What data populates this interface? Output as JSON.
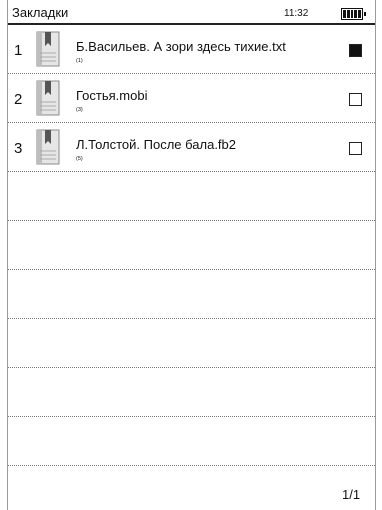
{
  "status": {
    "title": "Закладки",
    "time": "11:32",
    "battery_icon": "battery-full-icon"
  },
  "bookmarks": [
    {
      "index": "1",
      "title": "Б.Васильев. А зори здесь тихие.txt",
      "count": "(1)",
      "checked": true
    },
    {
      "index": "2",
      "title": "Гостья.mobi",
      "count": "(3)",
      "checked": false
    },
    {
      "index": "3",
      "title": "Л.Толстой. После бала.fb2",
      "count": "(5)",
      "checked": false
    }
  ],
  "pager": "1/1"
}
